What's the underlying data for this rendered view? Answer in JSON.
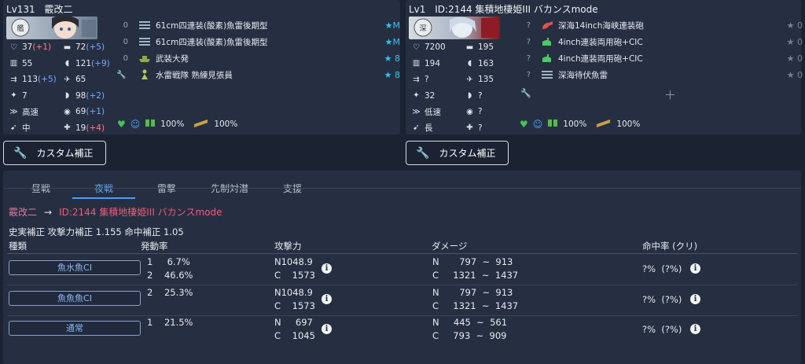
{
  "left_ship": {
    "level": "Lv131",
    "name": "霰改二",
    "stats": [
      {
        "a_icon": "hp-icon",
        "a_val": "37",
        "a_mod": "(+1)",
        "a_cls": "dn",
        "b_icon": "firepower-icon",
        "b_val": "72",
        "b_mod": "(+5)",
        "b_cls": "up"
      },
      {
        "a_icon": "armor-icon",
        "a_val": "55",
        "a_mod": "",
        "a_cls": "",
        "b_icon": "torpedo-icon",
        "b_val": "121",
        "b_mod": "(+9)",
        "b_cls": "up"
      },
      {
        "a_icon": "evasion-icon",
        "a_val": "113",
        "a_mod": "(+5)",
        "a_cls": "up",
        "b_icon": "aa-icon",
        "b_val": "65",
        "b_mod": "",
        "b_cls": ""
      },
      {
        "a_icon": "aircraft-icon",
        "a_val": "7",
        "a_mod": "",
        "a_cls": "",
        "b_icon": "asw-icon",
        "b_val": "98",
        "b_mod": "(+2)",
        "b_cls": "up"
      },
      {
        "a_icon": "speed-icon",
        "a_val": "高速",
        "a_mod": "",
        "a_cls": "",
        "b_icon": "los-icon",
        "b_val": "69",
        "b_mod": "(+1)",
        "b_cls": "up"
      },
      {
        "a_icon": "range-icon",
        "a_val": "中",
        "a_mod": "",
        "a_cls": "",
        "b_icon": "luck-icon",
        "b_val": "19",
        "b_mod": "(+4)",
        "b_cls": "dn"
      }
    ],
    "equipment": [
      {
        "slot": "0",
        "icon": "torpedo-equip-icon",
        "name": "61cm四連装(酸素)魚雷後期型",
        "star": "★M",
        "grey": false
      },
      {
        "slot": "0",
        "icon": "torpedo-equip-icon",
        "name": "61cm四連装(酸素)魚雷後期型",
        "star": "★M",
        "grey": false
      },
      {
        "slot": "0",
        "icon": "landing-craft-icon",
        "name": "武装大発",
        "star": "★ 8",
        "grey": false
      },
      {
        "slot": "",
        "icon": "lookout-icon",
        "name": "水雷戦隊 熟練見張員",
        "star": "★ 8",
        "grey": false
      }
    ],
    "condition": "100%",
    "ammo": "100%"
  },
  "right_ship": {
    "level": "Lv1",
    "name": "ID:2144 集積地棲姫III バカンスmode",
    "stats": [
      {
        "a_icon": "hp-icon",
        "a_val": "7200",
        "a_mod": "",
        "a_cls": "",
        "b_icon": "firepower-icon",
        "b_val": "195",
        "b_mod": "",
        "b_cls": ""
      },
      {
        "a_icon": "armor-icon",
        "a_val": "194",
        "a_mod": "",
        "a_cls": "",
        "b_icon": "torpedo-icon",
        "b_val": "163",
        "b_mod": "",
        "b_cls": ""
      },
      {
        "a_icon": "evasion-icon",
        "a_val": "?",
        "a_mod": "",
        "a_cls": "",
        "b_icon": "aa-icon",
        "b_val": "135",
        "b_mod": "",
        "b_cls": ""
      },
      {
        "a_icon": "aircraft-icon",
        "a_val": "32",
        "a_mod": "",
        "a_cls": "",
        "b_icon": "asw-icon",
        "b_val": "?",
        "b_mod": "",
        "b_cls": ""
      },
      {
        "a_icon": "speed-icon",
        "a_val": "低速",
        "a_mod": "",
        "a_cls": "",
        "b_icon": "los-icon",
        "b_val": "?",
        "b_mod": "",
        "b_cls": ""
      },
      {
        "a_icon": "range-icon",
        "a_val": "長",
        "a_mod": "",
        "a_cls": "",
        "b_icon": "luck-icon",
        "b_val": "?",
        "b_mod": "",
        "b_cls": ""
      }
    ],
    "equipment": [
      {
        "slot": "?",
        "icon": "heavy-gun-icon",
        "name": "深海14inch海峡連装砲",
        "star": "★ 0",
        "grey": true
      },
      {
        "slot": "?",
        "icon": "secondary-gun-icon",
        "name": "4inch連装両用砲+CIC",
        "star": "★ 0",
        "grey": true
      },
      {
        "slot": "?",
        "icon": "secondary-gun-icon",
        "name": "4inch連装両用砲+CIC",
        "star": "★ 0",
        "grey": true
      },
      {
        "slot": "?",
        "icon": "torpedo-equip-icon",
        "name": "深海待伏魚雷",
        "star": "★ 0",
        "grey": true
      }
    ],
    "condition": "100%",
    "ammo": "100%"
  },
  "buttons": {
    "custom_label": "カスタム補正"
  },
  "tabs": [
    "昼戦",
    "夜戦",
    "雷撃",
    "先制対潜",
    "支援"
  ],
  "active_tab": 1,
  "matchup": {
    "attacker": "霰改二",
    "arrow": "→",
    "defender": "ID:2144 集積地棲姫III バカンスmode"
  },
  "bonus_text": "史実補正 攻撃力補正 1.155 命中補正 1.05",
  "table": {
    "headers": [
      "種類",
      "発動率",
      "攻撃力",
      "ダメージ",
      "命中率 (クリ)"
    ],
    "rows": [
      {
        "kind": "魚水魚CI",
        "lines": [
          {
            "rate": "1     6.7%",
            "atk": "N1048.9",
            "dmg": "N       797  ~  913"
          },
          {
            "rate": "2    46.6%",
            "atk": "C    1573",
            "dmg": "C     1321  ~  1437"
          }
        ],
        "hit": "?%  (?%)"
      },
      {
        "kind": "魚魚魚CI",
        "lines": [
          {
            "rate": "2    25.3%",
            "atk": "N1048.9",
            "dmg": "N       797  ~  913"
          },
          {
            "rate": "",
            "atk": "C    1573",
            "dmg": "C     1321  ~  1437"
          }
        ],
        "hit": "?%  (?%)"
      },
      {
        "kind": "通常",
        "lines": [
          {
            "rate": "1    21.5%",
            "atk": "N     697",
            "dmg": "N     445  ~  561"
          },
          {
            "rate": "",
            "atk": "C    1045",
            "dmg": "C     793  ~  909"
          }
        ],
        "hit": "?%  (?%)"
      }
    ]
  },
  "colors": {
    "accent": "#4e9bf4",
    "star": "#36c3f0",
    "pink": "#ef5a7a",
    "mod_up": "#7aa7ff",
    "mod_down": "#ff7b8a"
  }
}
